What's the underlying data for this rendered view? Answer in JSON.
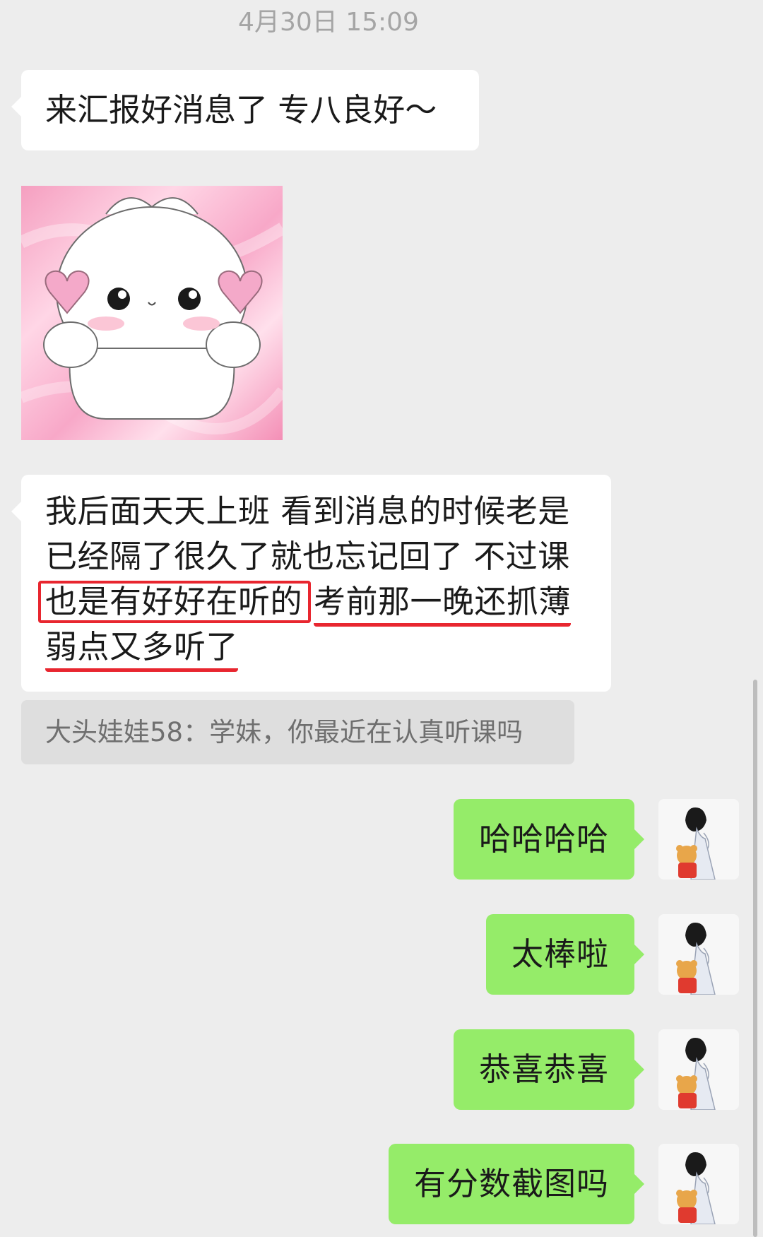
{
  "timestamp": "4月30日 15:09",
  "messages": [
    {
      "side": "left",
      "type": "text",
      "text": "来汇报好消息了 专八良好～"
    },
    {
      "side": "left",
      "type": "sticker",
      "sticker": "white-bunny-holding-hearts"
    },
    {
      "side": "left",
      "type": "text",
      "lines": [
        "我后面天天上班 看到消息的时候老是",
        "已经隔了很久了就也忘记回了 不过课"
      ],
      "line3_boxed": "也是有好好在听的",
      "line3_underlined": "考前那一晚还抓薄",
      "line4_underlined": "弱点又多听了",
      "annotation_color": "#e8262f"
    },
    {
      "side": "left",
      "type": "quote",
      "text": "大头娃娃58：学妹，你最近在认真听课吗"
    },
    {
      "side": "right",
      "type": "text",
      "text": "哈哈哈哈",
      "avatar": "boy-with-winnie-the-pooh-avatar"
    },
    {
      "side": "right",
      "type": "text",
      "text": "太棒啦",
      "avatar": "boy-with-winnie-the-pooh-avatar"
    },
    {
      "side": "right",
      "type": "text",
      "text": "恭喜恭喜",
      "avatar": "boy-with-winnie-the-pooh-avatar"
    },
    {
      "side": "right",
      "type": "text",
      "text": "有分数截图吗",
      "avatar": "boy-with-winnie-the-pooh-avatar"
    }
  ],
  "colors": {
    "background": "#ededed",
    "bubble_left": "#ffffff",
    "bubble_right": "#95ec69",
    "quote_background": "#dedede",
    "highlight": "#e8262f"
  }
}
